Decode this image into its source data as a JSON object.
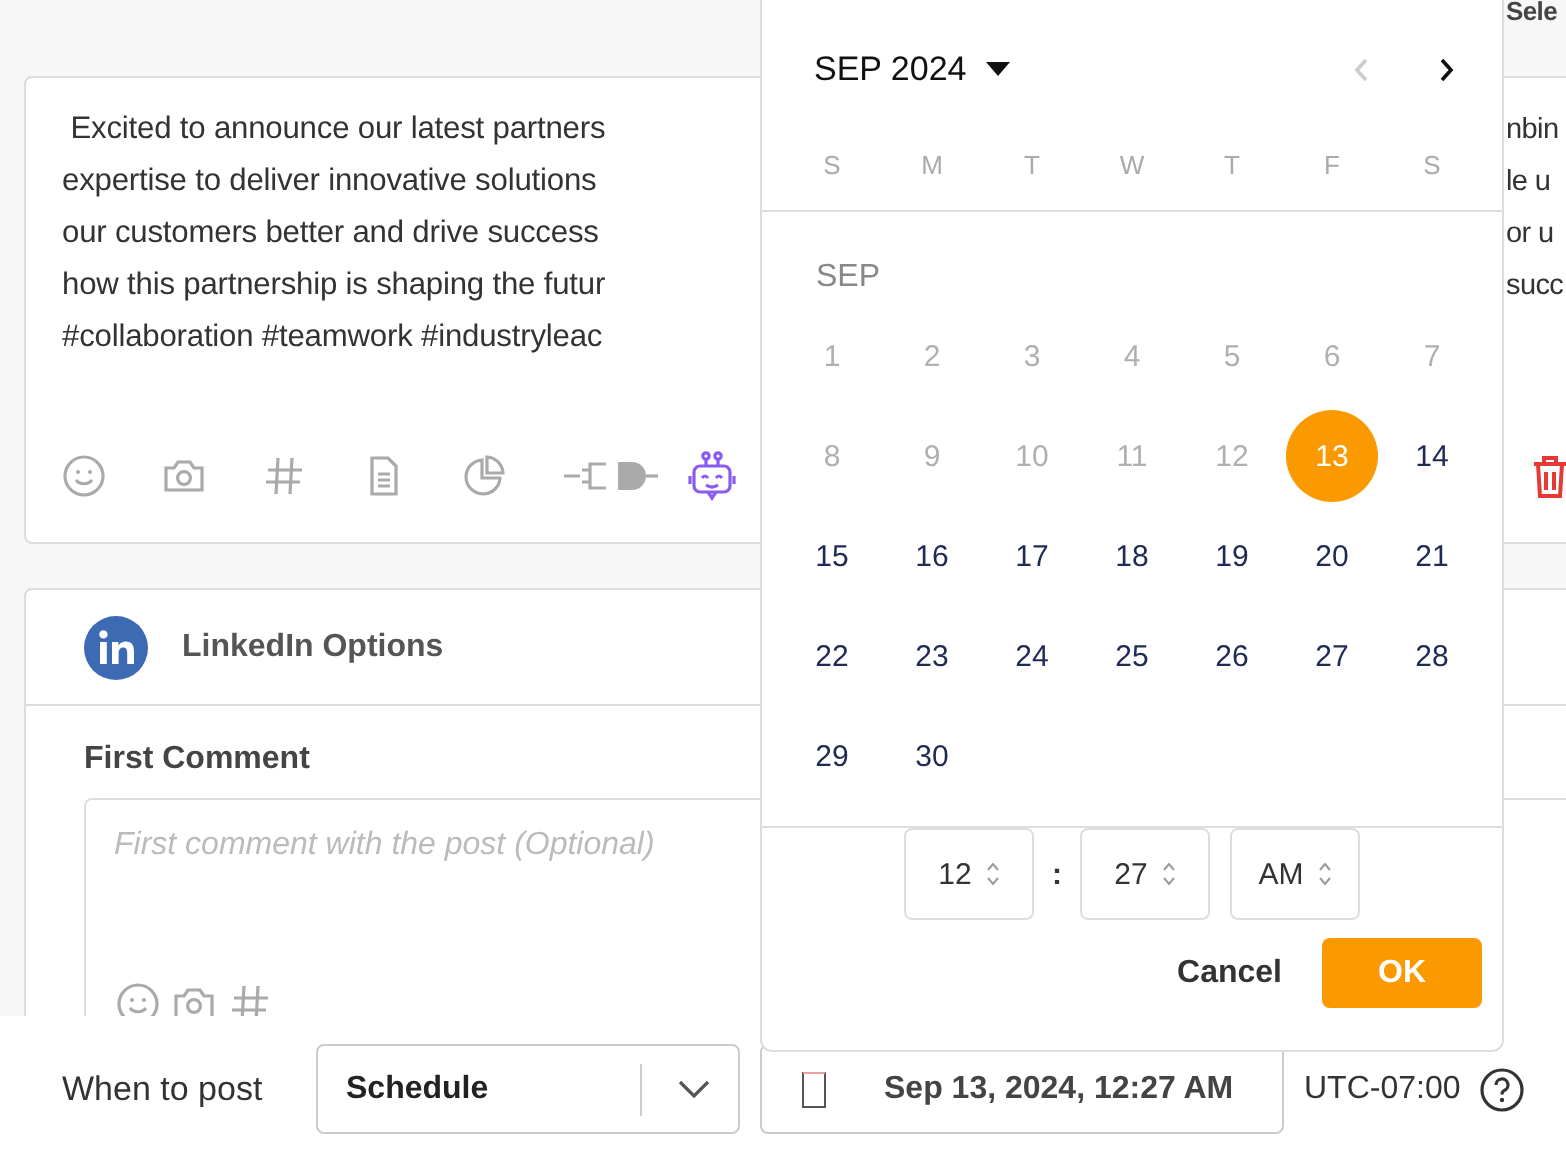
{
  "header": {
    "title": "Sele"
  },
  "post": {
    "lines": [
      {
        "left": " Excited to announce our latest partners",
        "right": "nbin"
      },
      {
        "left": "expertise to deliver innovative solutions",
        "right": "le u"
      },
      {
        "left": "our customers better and drive success",
        "right": "or u"
      },
      {
        "left": "how this partnership is shaping the futur",
        "right": "succ"
      },
      {
        "left": "#collaboration #teamwork #industryleac"
      }
    ]
  },
  "linkedin": {
    "title": "LinkedIn Options",
    "first_comment": {
      "label": "First Comment",
      "placeholder": "First comment with the post (Optional)"
    }
  },
  "schedule": {
    "label": "When to post",
    "mode": "Schedule",
    "datetime": "Sep 13, 2024, 12:27 AM",
    "timezone": "UTC-07:00"
  },
  "calendar": {
    "month_year": "SEP 2024",
    "prev_disabled": true,
    "weekdays": [
      "S",
      "M",
      "T",
      "W",
      "T",
      "F",
      "S"
    ],
    "month_label": "SEP",
    "days": [
      {
        "label": "1",
        "disabled": true,
        "selected": false
      },
      {
        "label": "2",
        "disabled": true,
        "selected": false
      },
      {
        "label": "3",
        "disabled": true,
        "selected": false
      },
      {
        "label": "4",
        "disabled": true,
        "selected": false
      },
      {
        "label": "5",
        "disabled": true,
        "selected": false
      },
      {
        "label": "6",
        "disabled": true,
        "selected": false
      },
      {
        "label": "7",
        "disabled": true,
        "selected": false
      },
      {
        "label": "8",
        "disabled": true,
        "selected": false
      },
      {
        "label": "9",
        "disabled": true,
        "selected": false
      },
      {
        "label": "10",
        "disabled": true,
        "selected": false
      },
      {
        "label": "11",
        "disabled": true,
        "selected": false
      },
      {
        "label": "12",
        "disabled": true,
        "selected": false
      },
      {
        "label": "13",
        "disabled": false,
        "selected": true
      },
      {
        "label": "14",
        "disabled": false,
        "selected": false
      },
      {
        "label": "15",
        "disabled": false,
        "selected": false
      },
      {
        "label": "16",
        "disabled": false,
        "selected": false
      },
      {
        "label": "17",
        "disabled": false,
        "selected": false
      },
      {
        "label": "18",
        "disabled": false,
        "selected": false
      },
      {
        "label": "19",
        "disabled": false,
        "selected": false
      },
      {
        "label": "20",
        "disabled": false,
        "selected": false
      },
      {
        "label": "21",
        "disabled": false,
        "selected": false
      },
      {
        "label": "22",
        "disabled": false,
        "selected": false
      },
      {
        "label": "23",
        "disabled": false,
        "selected": false
      },
      {
        "label": "24",
        "disabled": false,
        "selected": false
      },
      {
        "label": "25",
        "disabled": false,
        "selected": false
      },
      {
        "label": "26",
        "disabled": false,
        "selected": false
      },
      {
        "label": "27",
        "disabled": false,
        "selected": false
      },
      {
        "label": "28",
        "disabled": false,
        "selected": false
      },
      {
        "label": "29",
        "disabled": false,
        "selected": false
      },
      {
        "label": "30",
        "disabled": false,
        "selected": false
      }
    ],
    "time": {
      "hour": "12",
      "separator": ":",
      "minute": "27",
      "period": "AM"
    },
    "buttons": {
      "cancel": "Cancel",
      "ok": "OK"
    }
  }
}
